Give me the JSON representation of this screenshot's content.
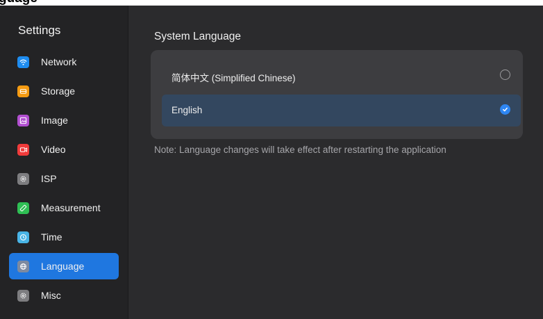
{
  "header_fragment": "guage",
  "sidebar": {
    "title": "Settings",
    "items": [
      {
        "label": "Network",
        "icon": "wifi-icon",
        "color": "#1e8cf0"
      },
      {
        "label": "Storage",
        "icon": "storage-icon",
        "color": "#f59b12"
      },
      {
        "label": "Image",
        "icon": "image-icon",
        "color": "#b24fd1"
      },
      {
        "label": "Video",
        "icon": "video-icon",
        "color": "#f03b3b"
      },
      {
        "label": "ISP",
        "icon": "gear-icon",
        "color": "#7d7d80"
      },
      {
        "label": "Measurement",
        "icon": "ruler-icon",
        "color": "#2fbf54"
      },
      {
        "label": "Time",
        "icon": "clock-icon",
        "color": "#49b4e6"
      },
      {
        "label": "Language",
        "icon": "globe-icon",
        "color": "#7d8aa0",
        "active": true
      },
      {
        "label": "Misc",
        "icon": "gear-icon",
        "color": "#7d7d80"
      }
    ],
    "active_color": "#1f77e0"
  },
  "main": {
    "section_title": "System Language",
    "options": [
      {
        "label": "简体中文 (Simplified Chinese)",
        "selected": false
      },
      {
        "label": "English",
        "selected": true
      }
    ],
    "note": "Note: Language changes will take effect after restarting the application"
  }
}
